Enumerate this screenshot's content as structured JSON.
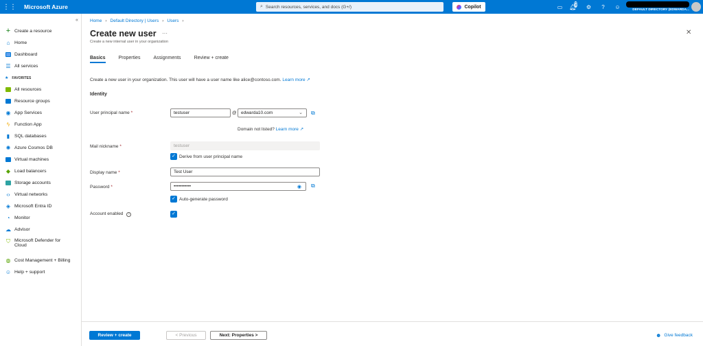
{
  "topbar": {
    "brand": "Microsoft Azure",
    "search_placeholder": "Search resources, services, and docs (G+/)",
    "copilot_label": "Copilot",
    "notification_count": "9",
    "directory": "DEFAULT DIRECTORY (EDWARDA..."
  },
  "sidebar": {
    "favorites_label": "FAVORITES",
    "items": [
      {
        "label": "Create a resource",
        "icon": "plus-icon"
      },
      {
        "label": "Home",
        "icon": "home-icon"
      },
      {
        "label": "Dashboard",
        "icon": "dashboard-icon"
      },
      {
        "label": "All services",
        "icon": "all-services-icon"
      },
      {
        "label": "All resources",
        "icon": "all-resources-icon"
      },
      {
        "label": "Resource groups",
        "icon": "resource-groups-icon"
      },
      {
        "label": "App Services",
        "icon": "app-services-icon"
      },
      {
        "label": "Function App",
        "icon": "function-app-icon"
      },
      {
        "label": "SQL databases",
        "icon": "sql-databases-icon"
      },
      {
        "label": "Azure Cosmos DB",
        "icon": "cosmos-db-icon"
      },
      {
        "label": "Virtual machines",
        "icon": "virtual-machines-icon"
      },
      {
        "label": "Load balancers",
        "icon": "load-balancers-icon"
      },
      {
        "label": "Storage accounts",
        "icon": "storage-accounts-icon"
      },
      {
        "label": "Virtual networks",
        "icon": "virtual-networks-icon"
      },
      {
        "label": "Microsoft Entra ID",
        "icon": "entra-id-icon"
      },
      {
        "label": "Monitor",
        "icon": "monitor-icon"
      },
      {
        "label": "Advisor",
        "icon": "advisor-icon"
      },
      {
        "label": "Microsoft Defender for",
        "label2": "Cloud",
        "icon": "defender-icon"
      },
      {
        "label": "Cost Management + Billing",
        "icon": "cost-management-icon"
      },
      {
        "label": "Help + support",
        "icon": "help-support-icon"
      }
    ]
  },
  "breadcrumb": [
    "Home",
    "Default Directory | Users",
    "Users"
  ],
  "page": {
    "title": "Create new user",
    "subtitle": "Create a new internal user in your organization",
    "tabs": [
      "Basics",
      "Properties",
      "Assignments",
      "Review + create"
    ],
    "intro": "Create a new user in your organization. This user will have a user name like alice@contoso.com.",
    "learn_more": "Learn more",
    "section": "Identity"
  },
  "form": {
    "upn_label": "User principal name",
    "upn_value": "testuser",
    "at": "@",
    "domain_value": "edwarda10.com",
    "domain_not_listed": "Domain not listed?",
    "domain_learn_more": "Learn more",
    "mail_label": "Mail nickname",
    "mail_value": "testuser",
    "derive_label": "Derive from user principal name",
    "display_label": "Display name",
    "display_value": "Test User",
    "password_label": "Password",
    "password_value": "•••••••••••",
    "autogen_label": "Auto-generate password",
    "account_enabled_label": "Account enabled",
    "required_mark": "*"
  },
  "footer": {
    "review_create": "Review + create",
    "previous": "< Previous",
    "next": "Next: Properties >",
    "feedback": "Give feedback"
  },
  "colors": {
    "accent": "#0078d4",
    "required": "#a4262c"
  }
}
